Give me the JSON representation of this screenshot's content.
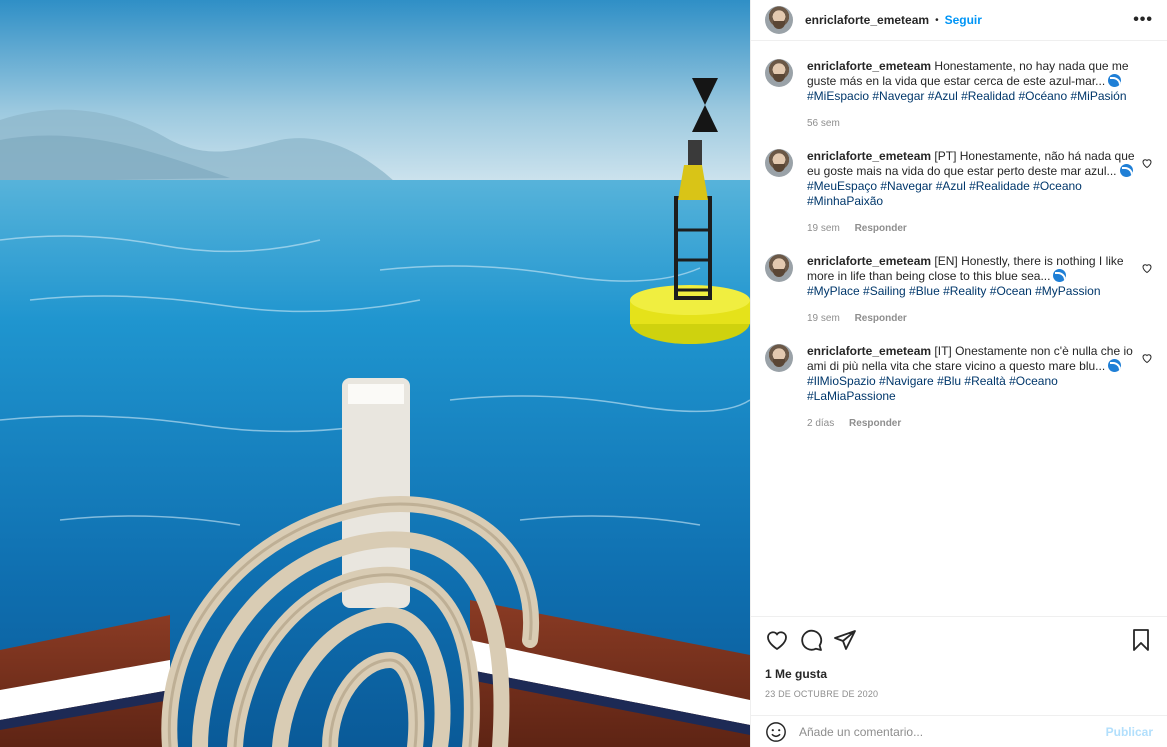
{
  "post": {
    "username": "enriclaforte_emeteam",
    "separator": "•",
    "follow_label": "Seguir",
    "more_label": "•••"
  },
  "photo": {
    "subject": "rope coiled on boat bow with yellow buoy on blue sea"
  },
  "comments": [
    {
      "user": "enriclaforte_emeteam",
      "text": "Honestamente, no hay nada que me guste más en la vida que estar cerca de este azul-mar...",
      "tags": "#MiEspacio #Navegar #Azul #Realidad #Océano #MiPasión",
      "time": "56 sem",
      "reply": ""
    },
    {
      "user": "enriclaforte_emeteam",
      "text": "[PT] Honestamente, não há nada que eu goste mais na vida do que estar perto deste mar azul...",
      "tags": "#MeuEspaço #Navegar #Azul #Realidade #Oceano #MinhaPaixão",
      "time": "19 sem",
      "reply": "Responder"
    },
    {
      "user": "enriclaforte_emeteam",
      "text": "[EN] Honestly, there is nothing I like more in life than being close to this blue sea...",
      "tags": "#MyPlace #Sailing #Blue #Reality #Ocean #MyPassion",
      "time": "19 sem",
      "reply": "Responder"
    },
    {
      "user": "enriclaforte_emeteam",
      "text": "[IT] Onestamente non c'è nulla che io ami di più nella vita che stare vicino a questo mare blu...",
      "tags": "#IlMioSpazio #Navigare #Blu #Realtà #Oceano #LaMiaPassione",
      "time": "2 días",
      "reply": "Responder"
    }
  ],
  "icons": {
    "like": "heart-icon",
    "comment": "comment-icon",
    "share": "paper-plane-icon",
    "save": "bookmark-icon",
    "emoji": "smiley-icon",
    "comment_like": "heart-icon",
    "emoji_in_text": "wave-emoji"
  },
  "stats": {
    "likes": "1 Me gusta",
    "date": "23 DE OCTUBRE DE 2020"
  },
  "composer": {
    "placeholder": "Añade un comentario...",
    "publish_label": "Publicar"
  },
  "colors": {
    "link": "#0095f6",
    "hashtag": "#00376b",
    "muted": "#8e8e8e",
    "publish_disabled": "#b2dffc"
  }
}
